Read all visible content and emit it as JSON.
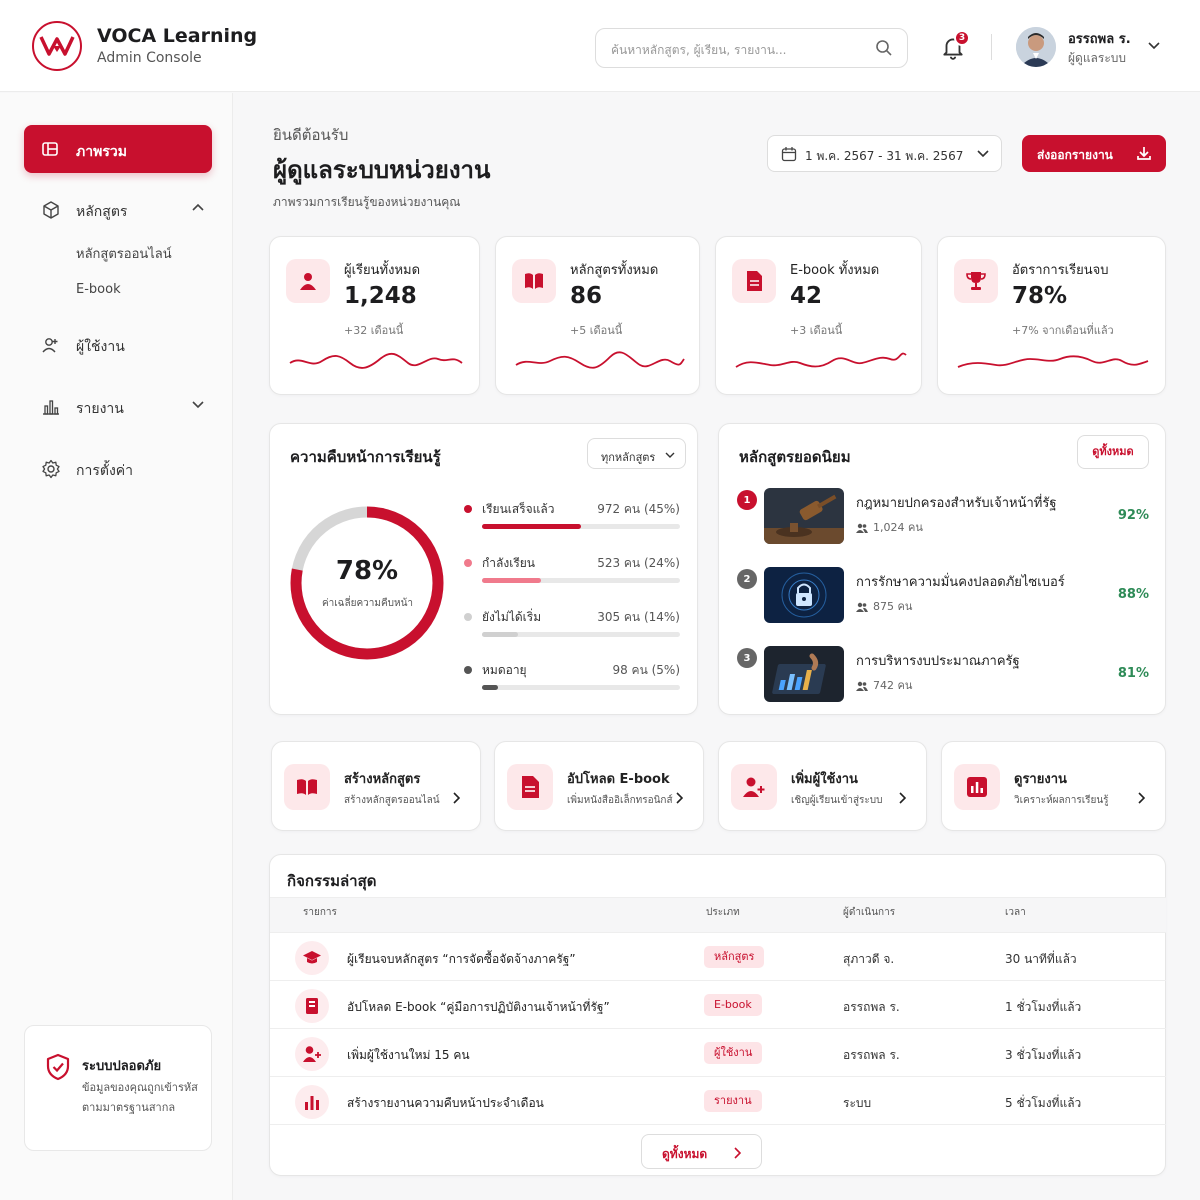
{
  "colors": {
    "brand": "#c8102e",
    "success": "#2e8b57"
  },
  "header": {
    "brand_title": "VOCA Learning",
    "brand_subtitle": "Admin Console",
    "search_placeholder": "ค้นหาหลักสูตร, ผู้เรียน, รายงาน...",
    "notification_count": "3",
    "user_name": "อรรถพล ร.",
    "user_role": "ผู้ดูแลระบบ"
  },
  "sidebar": {
    "items": [
      {
        "label": "ภาพรวม",
        "icon": "dashboard-icon",
        "active": true
      },
      {
        "label": "หลักสูตร",
        "icon": "cube-icon",
        "expanded": true
      },
      {
        "label": "ผู้ใช้งาน",
        "icon": "users-icon"
      },
      {
        "label": "รายงาน",
        "icon": "bar-chart-icon"
      },
      {
        "label": "การตั้งค่า",
        "icon": "gear-icon"
      }
    ],
    "subitems": [
      "หลักสูตรออนไลน์",
      "E-book"
    ],
    "security": {
      "title": "ระบบปลอดภัย",
      "desc": "ข้อมูลของคุณถูกเข้ารหัสตามมาตรฐานสากล"
    }
  },
  "page": {
    "greeting": "ยินดีต้อนรับ",
    "title": "ผู้ดูแลระบบหน่วยงาน",
    "subtitle": "ภาพรวมการเรียนรู้ของหน่วยงานคุณ",
    "date_range": "1 พ.ค. 2567 - 31 พ.ค. 2567",
    "export_label": "ส่งออกรายงาน"
  },
  "stats": [
    {
      "label": "ผู้เรียนทั้งหมด",
      "value": "1,248",
      "change": "+32 เดือนนี้",
      "icon": "user-icon"
    },
    {
      "label": "หลักสูตรทั้งหมด",
      "value": "86",
      "change": "+5 เดือนนี้",
      "icon": "book-icon"
    },
    {
      "label": "E-book ทั้งหมด",
      "value": "42",
      "change": "+3 เดือนนี้",
      "icon": "document-icon"
    },
    {
      "label": "อัตราการเรียนจบ",
      "value": "78%",
      "change": "+7% จากเดือนที่แล้ว",
      "icon": "trophy-icon"
    }
  ],
  "progress": {
    "title": "ความคืบหน้าการเรียนรู้",
    "filter": "ทุกหลักสูตร",
    "percent": "78%",
    "percent_value": 78,
    "percent_label": "ค่าเฉลี่ยความคืบหน้า",
    "legend": [
      {
        "label": "เรียนเสร็จแล้ว",
        "count": "972 คน (45%)",
        "share": 0.5,
        "color": "#c8102e"
      },
      {
        "label": "กำลังเรียน",
        "count": "523 คน (24%)",
        "share": 0.3,
        "color": "#f07a8c"
      },
      {
        "label": "ยังไม่ได้เริ่ม",
        "count": "305 คน (14%)",
        "share": 0.18,
        "color": "#d0d0d0"
      },
      {
        "label": "หมดอายุ",
        "count": "98 คน (5%)",
        "share": 0.08,
        "color": "#555555"
      }
    ]
  },
  "popular": {
    "title": "หลักสูตรยอดนิยม",
    "view_all": "ดูทั้งหมด",
    "courses": [
      {
        "rank": "1",
        "name": "กฎหมายปกครองสำหรับเจ้าหน้าที่รัฐ",
        "students": "1,024 คน",
        "percent": "92%"
      },
      {
        "rank": "2",
        "name": "การรักษาความมั่นคงปลอดภัยไซเบอร์",
        "students": "875 คน",
        "percent": "88%"
      },
      {
        "rank": "3",
        "name": "การบริหารงบประมาณภาครัฐ",
        "students": "742 คน",
        "percent": "81%"
      }
    ]
  },
  "quick_actions": [
    {
      "title": "สร้างหลักสูตร",
      "desc": "สร้างหลักสูตรออนไลน์",
      "icon": "book-icon"
    },
    {
      "title": "อัปโหลด E-book",
      "desc": "เพิ่มหนังสืออิเล็กทรอนิกส์",
      "icon": "document-icon"
    },
    {
      "title": "เพิ่มผู้ใช้งาน",
      "desc": "เชิญผู้เรียนเข้าสู่ระบบ",
      "icon": "user-add-icon"
    },
    {
      "title": "ดูรายงาน",
      "desc": "วิเคราะห์ผลการเรียนรู้",
      "icon": "report-icon"
    }
  ],
  "activity": {
    "title": "กิจกรรมล่าสุด",
    "columns": [
      "รายการ",
      "ประเภท",
      "ผู้ดำเนินการ",
      "เวลา"
    ],
    "rows": [
      {
        "text": "ผู้เรียนจบหลักสูตร “การจัดซื้อจัดจ้างภาครัฐ”",
        "type": "หลักสูตร",
        "by": "สุภาวดี จ.",
        "time": "30 นาทีที่แล้ว",
        "icon": "graduation-cap-icon"
      },
      {
        "text": "อัปโหลด E-book “คู่มือการปฏิบัติงานเจ้าหน้าที่รัฐ”",
        "type": "E-book",
        "by": "อรรถพล ร.",
        "time": "1 ชั่วโมงที่แล้ว",
        "icon": "ebook-icon"
      },
      {
        "text": "เพิ่มผู้ใช้งานใหม่ 15 คน",
        "type": "ผู้ใช้งาน",
        "by": "อรรถพล ร.",
        "time": "3 ชั่วโมงที่แล้ว",
        "icon": "user-add-icon"
      },
      {
        "text": "สร้างรายงานความคืบหน้าประจำเดือน",
        "type": "รายงาน",
        "by": "ระบบ",
        "time": "5 ชั่วโมงที่แล้ว",
        "icon": "report-icon"
      }
    ],
    "view_all": "ดูทั้งหมด"
  }
}
